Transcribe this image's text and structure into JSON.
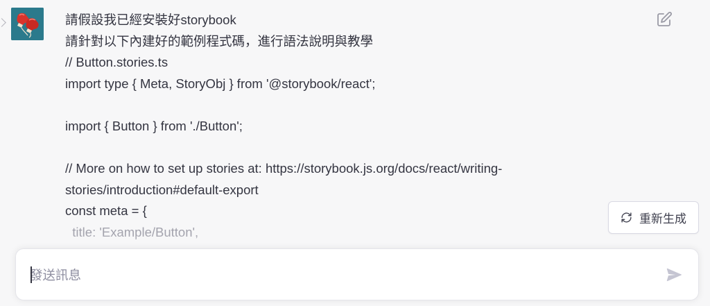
{
  "colors": {
    "page_bg": "#f7f7f8",
    "avatar_bg": "#2b7a8c",
    "text": "#343541",
    "muted": "#a3a3ad",
    "icon": "#9a9aa5"
  },
  "avatar": {
    "icon": "boxing-gloves-icon"
  },
  "message": {
    "lines": [
      "請假設我已經安裝好storybook",
      "請針對以下內建好的範例程式碼，進行語法說明與教學",
      "// Button.stories.ts",
      "import type { Meta, StoryObj } from '@storybook/react';",
      "",
      "import { Button } from './Button';",
      "",
      "// More on how to set up stories at: https://storybook.js.org/docs/react/writing-",
      "stories/introduction#default-export",
      "const meta = {",
      "  title: 'Example/Button',"
    ]
  },
  "actions": {
    "edit_icon": "pencil-square-icon",
    "regenerate_label": "重新生成",
    "regenerate_icon": "refresh-icon"
  },
  "composer": {
    "placeholder": "發送訊息",
    "value": "",
    "send_icon": "send-icon"
  }
}
